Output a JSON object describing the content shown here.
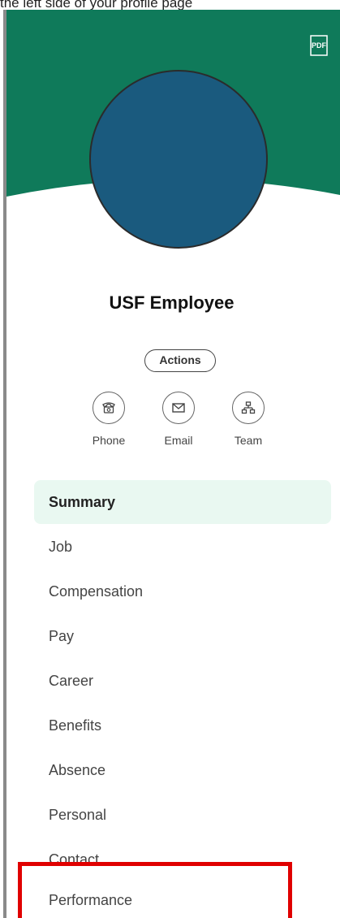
{
  "caption": "the left side of your profile page",
  "colors": {
    "banner": "#0f7a5a",
    "avatar": "#1a5a7e",
    "highlight": "#e00000",
    "active_bg": "#e9f8f1"
  },
  "header": {
    "pdf_icon": "pdf-icon",
    "pdf_label": "PDF"
  },
  "profile": {
    "name": "USF Employee",
    "actions_label": "Actions"
  },
  "contacts": [
    {
      "label": "Phone",
      "icon": "phone-icon"
    },
    {
      "label": "Email",
      "icon": "email-icon"
    },
    {
      "label": "Team",
      "icon": "team-icon"
    }
  ],
  "nav": {
    "items": [
      {
        "label": "Summary",
        "active": true
      },
      {
        "label": "Job"
      },
      {
        "label": "Compensation"
      },
      {
        "label": "Pay"
      },
      {
        "label": "Career"
      },
      {
        "label": "Benefits"
      },
      {
        "label": "Absence"
      },
      {
        "label": "Personal"
      },
      {
        "label": "Contact"
      },
      {
        "label": "Performance",
        "highlighted": true
      }
    ]
  }
}
